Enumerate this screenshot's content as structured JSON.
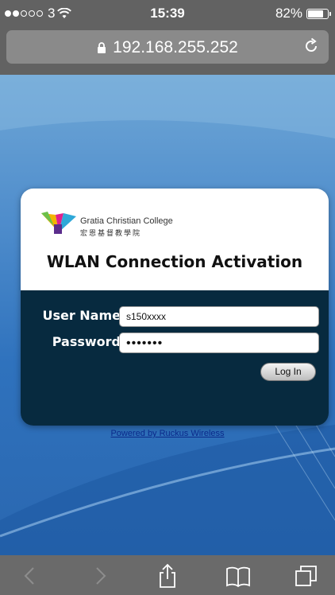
{
  "status_bar": {
    "carrier": "3",
    "time": "15:39",
    "battery": "82%",
    "battery_level": 0.82
  },
  "url_bar": {
    "url": "192.168.255.252"
  },
  "card": {
    "college_name_en": "Gratia Christian College",
    "college_name_zh": "宏恩基督教學院",
    "title": "WLAN Connection Activation",
    "username_label": "User Name",
    "username_value": "s150xxxx",
    "password_label": "Password",
    "password_masked": "•••••••",
    "login_button": "Log In"
  },
  "footer_link": "Powered by Ruckus Wireless",
  "toolbar": {
    "icons": [
      "back-icon",
      "forward-icon",
      "share-icon",
      "bookmarks-icon",
      "tabs-icon"
    ]
  }
}
